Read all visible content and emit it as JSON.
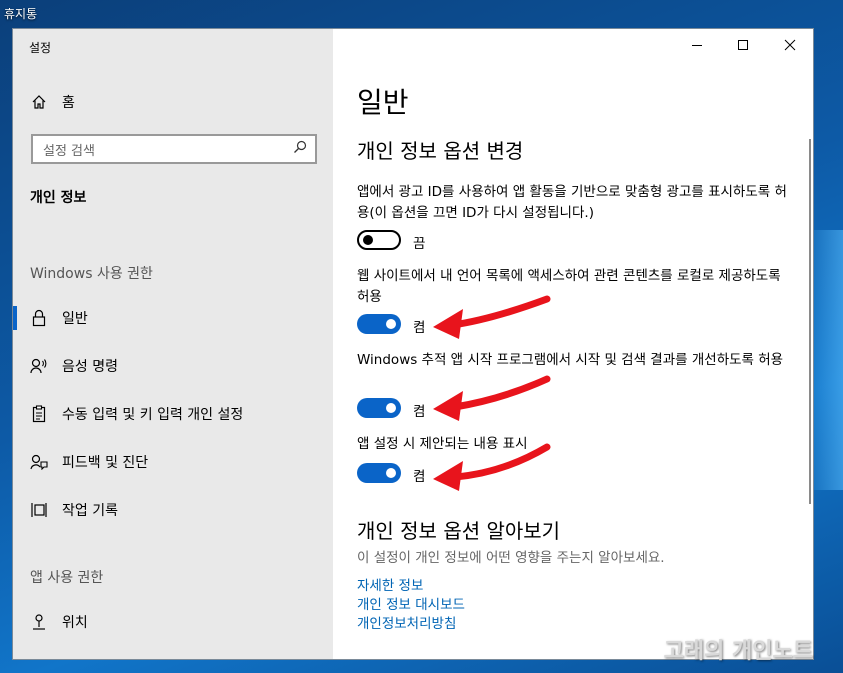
{
  "desktop": {
    "icon_label": "휴지통"
  },
  "window": {
    "title": "설정"
  },
  "sidebar": {
    "home_label": "홈",
    "search_placeholder": "설정 검색",
    "category": "개인 정보",
    "windows_permissions_label": "Windows 사용 권한",
    "windows_items": [
      {
        "label": "일반",
        "icon": "lock-icon",
        "selected": true
      },
      {
        "label": "음성 명령",
        "icon": "voice-icon"
      },
      {
        "label": "수동 입력 및 키 입력 개인 설정",
        "icon": "inking-icon"
      },
      {
        "label": "피드백 및 진단",
        "icon": "feedback-icon"
      },
      {
        "label": "작업 기록",
        "icon": "timeline-icon"
      }
    ],
    "app_permissions_label": "앱 사용 권한",
    "app_items": [
      {
        "label": "위치",
        "icon": "location-icon"
      }
    ]
  },
  "content": {
    "page_title": "일반",
    "section_title": "개인 정보 옵션 변경",
    "settings": [
      {
        "description": "앱에서 광고 ID를 사용하여 앱 활동을 기반으로 맞춤형 광고를 표시하도록 허용(이 옵션을 끄면 ID가 다시 설정됩니다.)",
        "state_label": "끔",
        "enabled": false
      },
      {
        "description": "웹 사이트에서 내 언어 목록에 액세스하여 관련 콘텐츠를 로컬로 제공하도록 허용",
        "state_label": "켬",
        "enabled": true
      },
      {
        "description": "Windows 추적 앱 시작 프로그램에서 시작 및 검색 결과를 개선하도록 허용",
        "state_label": "켬",
        "enabled": true
      },
      {
        "description": "앱 설정 시 제안되는 내용 표시",
        "state_label": "켬",
        "enabled": true
      }
    ],
    "learn_title": "개인 정보 옵션 알아보기",
    "learn_desc": "이 설정이 개인 정보에 어떤 영향을 주는지 알아보세요.",
    "links": [
      "자세한 정보",
      "개인 정보 대시보드",
      "개인정보처리방침"
    ]
  },
  "watermark": "고래의 개인노트",
  "colors": {
    "accent": "#0a64c8",
    "arrow": "#e8141c",
    "link": "#0064b4"
  }
}
